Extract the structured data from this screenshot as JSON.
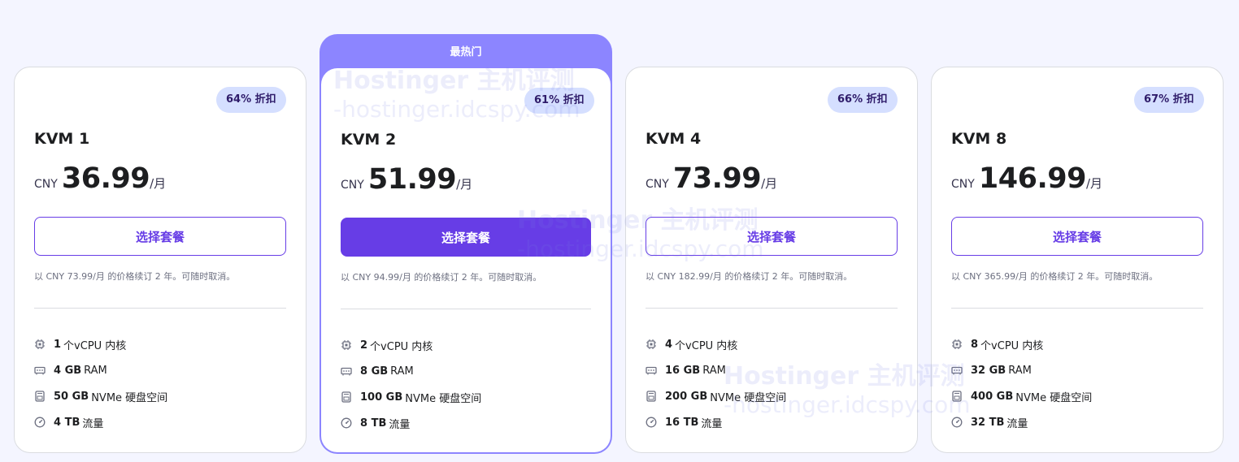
{
  "watermark": {
    "line1": "Hostinger 主机评测",
    "line2": "-hostinger.idcspy.com"
  },
  "plans": [
    {
      "name": "KVM 1",
      "badge": "64% 折扣",
      "currency": "CNY",
      "price": "36.99",
      "period": "/月",
      "button": "选择套餐",
      "renew": "以 CNY 73.99/月 的价格续订 2 年。可随时取消。",
      "features": [
        {
          "icon": "cpu-icon",
          "strong": "1",
          "text": "个vCPU 内核"
        },
        {
          "icon": "ram-icon",
          "strong": "4 GB",
          "text": "RAM"
        },
        {
          "icon": "disk-icon",
          "strong": "50 GB",
          "text": "NVMe 硬盘空间"
        },
        {
          "icon": "bandwidth-icon",
          "strong": "4 TB",
          "text": "流量"
        }
      ]
    },
    {
      "name": "KVM 2",
      "popular_label": "最热门",
      "badge": "61% 折扣",
      "currency": "CNY",
      "price": "51.99",
      "period": "/月",
      "button": "选择套餐",
      "renew": "以 CNY 94.99/月 的价格续订 2 年。可随时取消。",
      "features": [
        {
          "icon": "cpu-icon",
          "strong": "2",
          "text": "个vCPU 内核"
        },
        {
          "icon": "ram-icon",
          "strong": "8 GB",
          "text": "RAM"
        },
        {
          "icon": "disk-icon",
          "strong": "100 GB",
          "text": "NVMe 硬盘空间"
        },
        {
          "icon": "bandwidth-icon",
          "strong": "8 TB",
          "text": "流量"
        }
      ]
    },
    {
      "name": "KVM 4",
      "badge": "66% 折扣",
      "currency": "CNY",
      "price": "73.99",
      "period": "/月",
      "button": "选择套餐",
      "renew": "以 CNY 182.99/月 的价格续订 2 年。可随时取消。",
      "features": [
        {
          "icon": "cpu-icon",
          "strong": "4",
          "text": "个vCPU 内核"
        },
        {
          "icon": "ram-icon",
          "strong": "16 GB",
          "text": "RAM"
        },
        {
          "icon": "disk-icon",
          "strong": "200 GB",
          "text": "NVMe 硬盘空间"
        },
        {
          "icon": "bandwidth-icon",
          "strong": "16 TB",
          "text": "流量"
        }
      ]
    },
    {
      "name": "KVM 8",
      "badge": "67% 折扣",
      "currency": "CNY",
      "price": "146.99",
      "period": "/月",
      "button": "选择套餐",
      "renew": "以 CNY 365.99/月 的价格续订 2 年。可随时取消。",
      "features": [
        {
          "icon": "cpu-icon",
          "strong": "8",
          "text": "个vCPU 内核"
        },
        {
          "icon": "ram-icon",
          "strong": "32 GB",
          "text": "RAM"
        },
        {
          "icon": "disk-icon",
          "strong": "400 GB",
          "text": "NVMe 硬盘空间"
        },
        {
          "icon": "bandwidth-icon",
          "strong": "32 TB",
          "text": "流量"
        }
      ]
    }
  ],
  "colors": {
    "accent": "#673de6",
    "popular": "#8c85ff",
    "badge_bg": "#d5dfff",
    "page_bg": "#f4f5ff"
  }
}
